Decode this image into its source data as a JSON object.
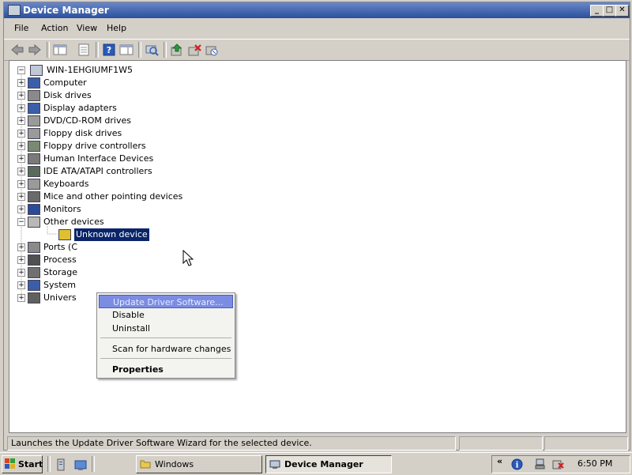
{
  "window": {
    "title": "Device Manager",
    "min_label": "_",
    "max_label": "□",
    "close_label": "✕"
  },
  "menu": [
    "File",
    "Action",
    "View",
    "Help"
  ],
  "toolbar": [
    "back-icon",
    "forward-icon",
    "show-hide-tree-icon",
    "properties-icon",
    "help-icon",
    "action-pane-icon",
    "scan-hardware-icon",
    "update-driver-icon",
    "uninstall-icon",
    "disable-icon"
  ],
  "tree": {
    "root": "WIN-1EHGIUMF1W5",
    "categories": [
      {
        "label": "Computer",
        "icon": "computer-icon",
        "color": "#3a5fa8"
      },
      {
        "label": "Disk drives",
        "icon": "disk-drive-icon",
        "color": "#8a8a8a"
      },
      {
        "label": "Display adapters",
        "icon": "display-adapter-icon",
        "color": "#3a5fa8"
      },
      {
        "label": "DVD/CD-ROM drives",
        "icon": "dvd-drive-icon",
        "color": "#9a9a9a"
      },
      {
        "label": "Floppy disk drives",
        "icon": "floppy-disk-icon",
        "color": "#9a9a9a"
      },
      {
        "label": "Floppy drive controllers",
        "icon": "floppy-controller-icon",
        "color": "#7a8a70"
      },
      {
        "label": "Human Interface Devices",
        "icon": "hid-icon",
        "color": "#7a7a7a"
      },
      {
        "label": "IDE ATA/ATAPI controllers",
        "icon": "ide-controller-icon",
        "color": "#5a6a5a"
      },
      {
        "label": "Keyboards",
        "icon": "keyboard-icon",
        "color": "#9a9a9a"
      },
      {
        "label": "Mice and other pointing devices",
        "icon": "mouse-icon",
        "color": "#6a6a6a"
      },
      {
        "label": "Monitors",
        "icon": "monitor-icon",
        "color": "#2a4a9a"
      },
      {
        "label": "Other devices",
        "icon": "other-devices-icon",
        "color": "#b8b8b8",
        "expanded": true
      },
      {
        "label": "Unknown device",
        "icon": "unknown-device-icon",
        "color": "#e0c030",
        "child": true,
        "selected": true
      },
      {
        "label": "Ports (C",
        "icon": "ports-icon",
        "color": "#8a8a8a"
      },
      {
        "label": "Process",
        "icon": "processor-icon",
        "color": "#505050"
      },
      {
        "label": "Storage",
        "icon": "storage-icon",
        "color": "#707070"
      },
      {
        "label": "System",
        "icon": "system-devices-icon",
        "color": "#3a5fa8"
      },
      {
        "label": "Univers",
        "icon": "usb-icon",
        "color": "#606060"
      }
    ]
  },
  "context_menu": {
    "update": "Update Driver Software...",
    "disable": "Disable",
    "uninstall": "Uninstall",
    "scan": "Scan for hardware changes",
    "properties": "Properties"
  },
  "status": {
    "text": "Launches the Update Driver Software Wizard for the selected device."
  },
  "taskbar": {
    "start": "Start",
    "tasks": [
      {
        "label": "Windows"
      },
      {
        "label": "Device Manager"
      }
    ],
    "time": "6:50 PM"
  },
  "colors": {
    "title_active": "#2a4f9b",
    "selection": "#0a246a",
    "menu_highlight": "#7b8ce3"
  }
}
